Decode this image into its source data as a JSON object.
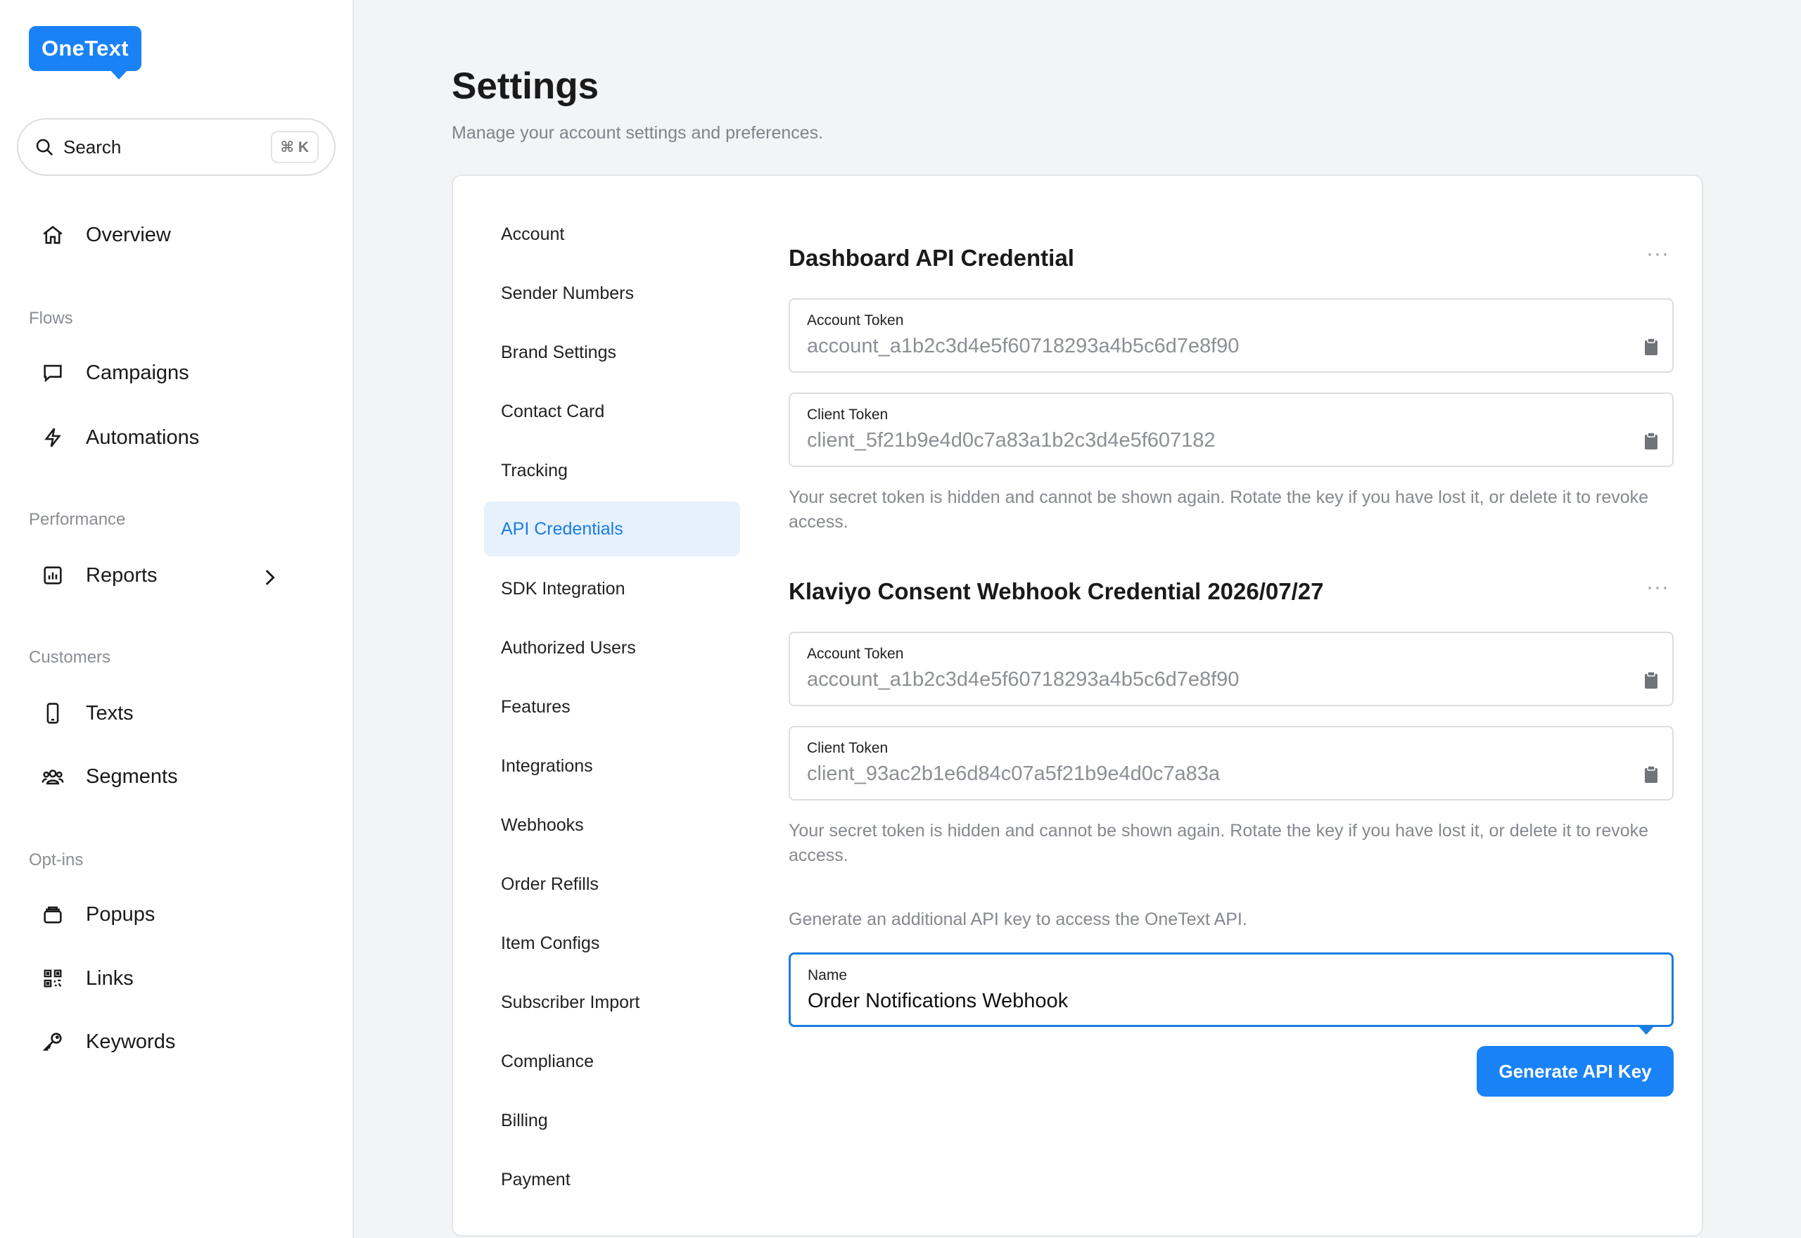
{
  "brand": {
    "logo_text": "OneText",
    "accent": "#1a82f7"
  },
  "search": {
    "label": "Search",
    "shortcut": "⌘ K"
  },
  "sidebar": {
    "items": [
      {
        "label": "Overview",
        "icon": "home-icon"
      },
      {
        "section": "Flows"
      },
      {
        "label": "Campaigns",
        "icon": "chat-bubble-icon"
      },
      {
        "label": "Automations",
        "icon": "lightning-icon"
      },
      {
        "section": "Performance"
      },
      {
        "label": "Reports",
        "icon": "bar-chart-icon",
        "has_chevron": true
      },
      {
        "section": "Customers"
      },
      {
        "label": "Texts",
        "icon": "phone-icon"
      },
      {
        "label": "Segments",
        "icon": "users-icon"
      },
      {
        "section": "Opt-ins"
      },
      {
        "label": "Popups",
        "icon": "layers-icon"
      },
      {
        "label": "Links",
        "icon": "qr-code-icon"
      },
      {
        "label": "Keywords",
        "icon": "key-icon"
      }
    ]
  },
  "page": {
    "title": "Settings",
    "subtitle": "Manage your account settings and preferences."
  },
  "settings_nav": {
    "items": [
      "Account",
      "Sender Numbers",
      "Brand Settings",
      "Contact Card",
      "Tracking",
      "API Credentials",
      "SDK Integration",
      "Authorized Users",
      "Features",
      "Integrations",
      "Webhooks",
      "Order Refills",
      "Item Configs",
      "Subscriber Import",
      "Compliance",
      "Billing",
      "Payment"
    ],
    "active": "API Credentials"
  },
  "credentials": [
    {
      "title": "Dashboard API Credential",
      "menu": "···",
      "account_token_label": "Account Token",
      "account_token": "account_a1b2c3d4e5f60718293a4b5c6d7e8f90",
      "client_token_label": "Client Token",
      "client_token": "client_5f21b9e4d0c7a83a1b2c3d4e5f607182",
      "hint": "Your secret token is hidden and cannot be shown again. Rotate the key if you have lost it, or delete it to revoke access."
    },
    {
      "title": "Klaviyo Consent Webhook Credential 2026/07/27",
      "menu": "···",
      "account_token_label": "Account Token",
      "account_token": "account_a1b2c3d4e5f60718293a4b5c6d7e8f90",
      "client_token_label": "Client Token",
      "client_token": "client_93ac2b1e6d84c07a5f21b9e4d0c7a83a",
      "hint": "Your secret token is hidden and cannot be shown again. Rotate the key if you have lost it, or delete it to revoke access."
    }
  ],
  "generate": {
    "hint": "Generate an additional API key to access the OneText API.",
    "name_label": "Name",
    "name_value": "Order Notifications Webhook",
    "button": "Generate API Key"
  }
}
